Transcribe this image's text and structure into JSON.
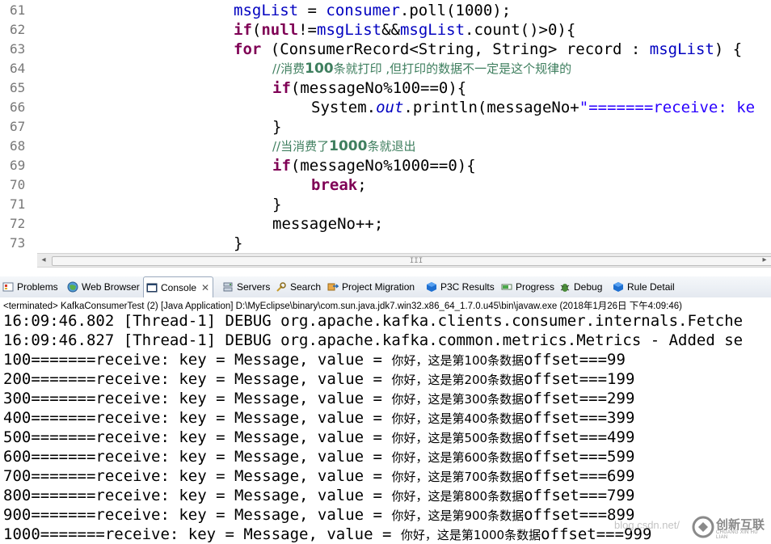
{
  "editor": {
    "line_numbers": [
      "61",
      "62",
      "63",
      "64",
      "65",
      "66",
      "67",
      "68",
      "69",
      "70",
      "71",
      "72",
      "73"
    ],
    "code": {
      "l61": {
        "a": "msgList",
        " b": " = ",
        "c": "consumer",
        ".": ".poll(1000);"
      },
      "l61_msgList": "msgList",
      "l61_eq": " = ",
      "l61_consumer": "consumer",
      "l61_rest": ".poll(1000);",
      "l62_if": "if",
      "l62_open": "(",
      "l62_null": "null",
      "l62_neq": "!=",
      "l62_msgList": "msgList",
      "l62_and": "&&",
      "l62_msgList2": "msgList",
      "l62_rest": ".count()>0){",
      "l63_for": "for",
      "l63_mid": " (ConsumerRecord<String, String> record : ",
      "l63_msgList": "msgList",
      "l63_rest": ") {",
      "l64_cmt_a": "//消费",
      "l64_cmt_num": "100",
      "l64_cmt_b": "条就打印 ,但打印的数据不一定是这个规律的",
      "l65_if": "if",
      "l65_rest": "(messageNo%100==0){",
      "l66_sys": "System.",
      "l66_out": "out",
      "l66_mid": ".println(messageNo+",
      "l66_str": "\"=======receive: ke",
      "l67": "}",
      "l68_cmt_a": "//当消费了",
      "l68_cmt_num": "1000",
      "l68_cmt_b": "条就退出",
      "l69_if": "if",
      "l69_rest": "(messageNo%1000==0){",
      "l70_break": "break",
      "l70_rest": ";",
      "l71": "}",
      "l72": "messageNo++;",
      "l73": "}"
    },
    "scroll_thumb_grip": "III"
  },
  "tabs": [
    {
      "label": "Problems"
    },
    {
      "label": "Web Browser"
    },
    {
      "label": "Console"
    },
    {
      "label": "Servers"
    },
    {
      "label": "Search"
    },
    {
      "label": "Project Migration"
    },
    {
      "label": "P3C Results"
    },
    {
      "label": "Progress"
    },
    {
      "label": "Debug"
    },
    {
      "label": "Rule Detail"
    }
  ],
  "console": {
    "header": "<terminated> KafkaConsumerTest (2) [Java Application] D:\\MyEclipse\\binary\\com.sun.java.jdk7.win32.x86_64_1.7.0.u45\\bin\\javaw.exe (2018年1月26日 下午4:09:46)",
    "log1": "16:09:46.802 [Thread-1] DEBUG org.apache.kafka.clients.consumer.internals.Fetche",
    "log2": "16:09:46.827 [Thread-1] DEBUG org.apache.kafka.common.metrics.Metrics - Added se",
    "rows": [
      {
        "prefix": "100=======receive: key = Message, value = ",
        "cn_a": "你好，这是第",
        "num": "100",
        "cn_b": "条数据",
        "suffix": "offset===99"
      },
      {
        "prefix": "200=======receive: key = Message, value = ",
        "cn_a": "你好，这是第",
        "num": "200",
        "cn_b": "条数据",
        "suffix": "offset===199"
      },
      {
        "prefix": "300=======receive: key = Message, value = ",
        "cn_a": "你好，这是第",
        "num": "300",
        "cn_b": "条数据",
        "suffix": "offset===299"
      },
      {
        "prefix": "400=======receive: key = Message, value = ",
        "cn_a": "你好，这是第",
        "num": "400",
        "cn_b": "条数据",
        "suffix": "offset===399"
      },
      {
        "prefix": "500=======receive: key = Message, value = ",
        "cn_a": "你好，这是第",
        "num": "500",
        "cn_b": "条数据",
        "suffix": "offset===499"
      },
      {
        "prefix": "600=======receive: key = Message, value = ",
        "cn_a": "你好，这是第",
        "num": "600",
        "cn_b": "条数据",
        "suffix": "offset===599"
      },
      {
        "prefix": "700=======receive: key = Message, value = ",
        "cn_a": "你好，这是第",
        "num": "700",
        "cn_b": "条数据",
        "suffix": "offset===699"
      },
      {
        "prefix": "800=======receive: key = Message, value = ",
        "cn_a": "你好，这是第",
        "num": "800",
        "cn_b": "条数据",
        "suffix": "offset===799"
      },
      {
        "prefix": "900=======receive: key = Message, value = ",
        "cn_a": "你好，这是第",
        "num": "900",
        "cn_b": "条数据",
        "suffix": "offset===899"
      },
      {
        "prefix": "1000=======receive: key = Message, value = ",
        "cn_a": "你好，这是第",
        "num": "1000",
        "cn_b": "条数据",
        "suffix": "offset===999"
      }
    ]
  },
  "watermark": {
    "text": "创新互联",
    "sub": "CHUANG XIN HU LIAN",
    "faint": "blog.csdn.net/"
  },
  "colors": {
    "keyword": "#7f0055",
    "field": "#0000c0",
    "string": "#2a00ff",
    "comment": "#3f7f5f"
  }
}
